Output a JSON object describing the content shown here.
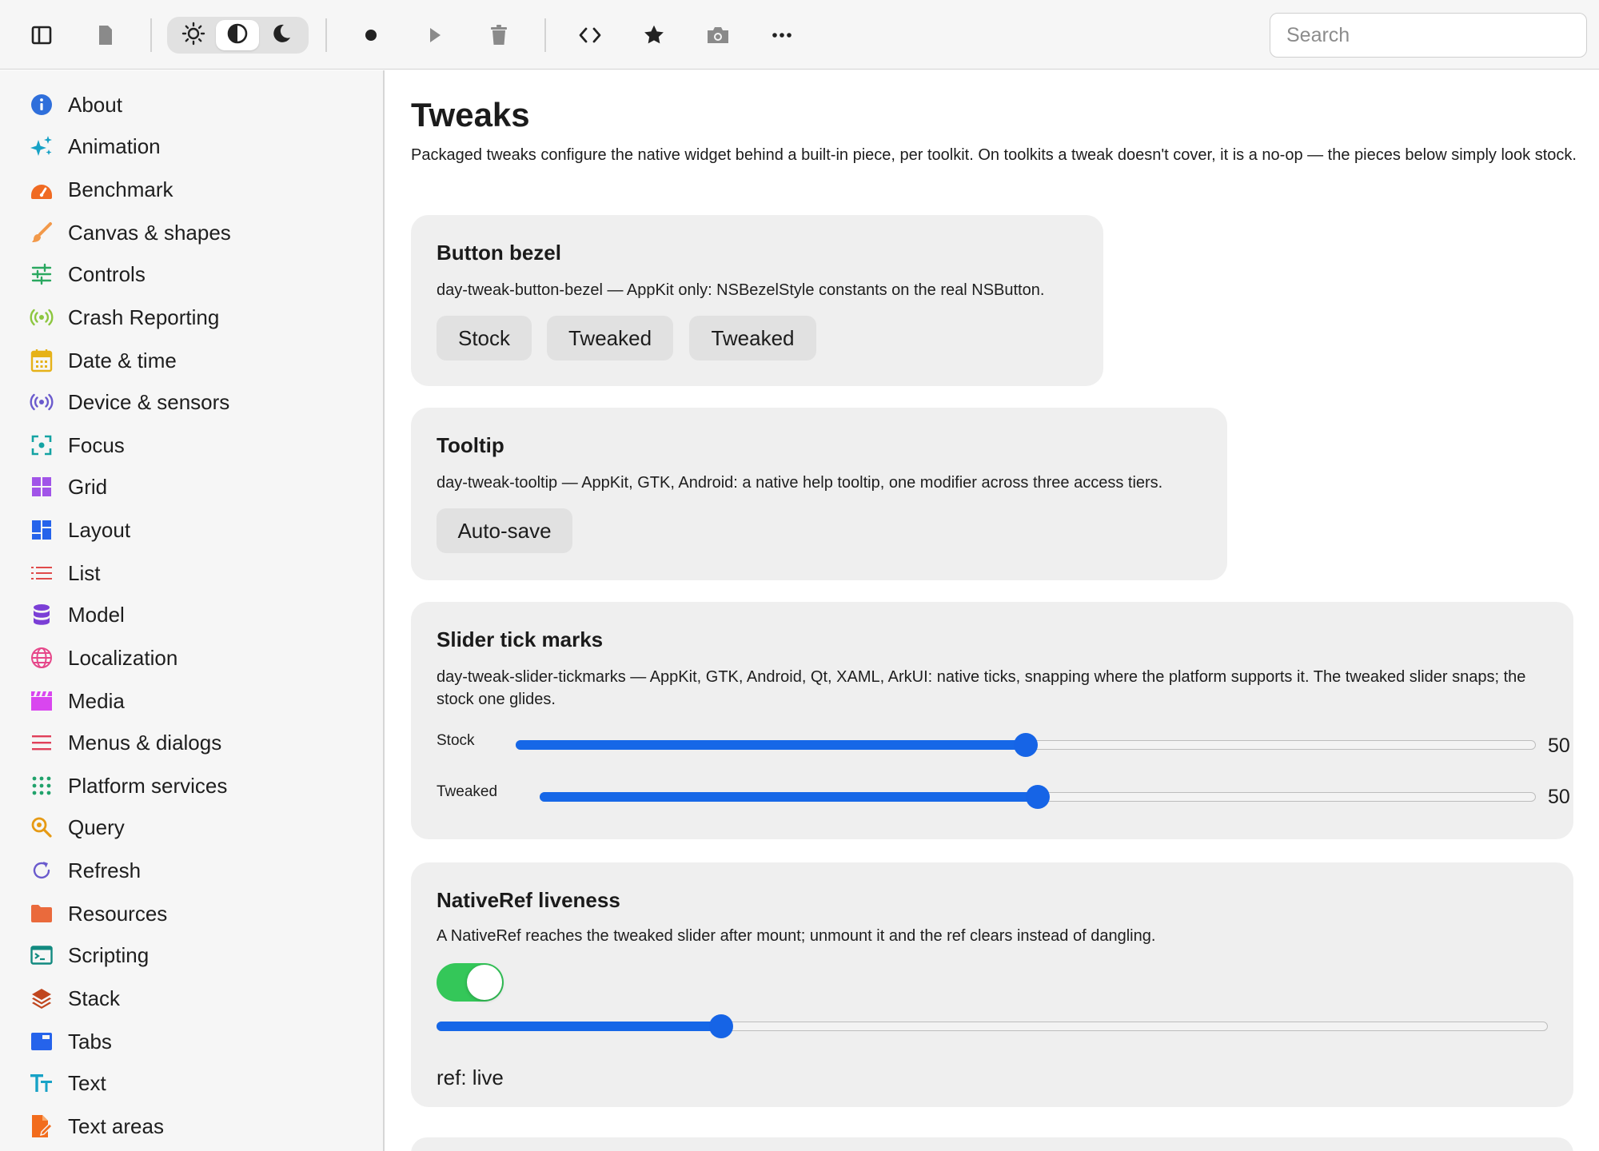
{
  "toolbar": {
    "icons": [
      "sidebar-toggle-icon",
      "document-icon",
      "sun-icon",
      "contrast-icon",
      "moon-icon",
      "record-icon",
      "play-icon",
      "trash-icon",
      "code-icon",
      "star-icon",
      "camera-icon",
      "more-icon"
    ],
    "theme_selected": "auto",
    "search_placeholder": "Search"
  },
  "sidebar": {
    "items": [
      {
        "label": "About",
        "icon": "info-icon",
        "color": "#2f6fdb"
      },
      {
        "label": "Animation",
        "icon": "sparkles-icon",
        "color": "#17a2c6"
      },
      {
        "label": "Benchmark",
        "icon": "gauge-icon",
        "color": "#f06a22"
      },
      {
        "label": "Canvas & shapes",
        "icon": "brush-icon",
        "color": "#f2994a"
      },
      {
        "label": "Controls",
        "icon": "sliders-icon",
        "color": "#2aa860"
      },
      {
        "label": "Crash Reporting",
        "icon": "broadcast-icon",
        "color": "#8cc63f"
      },
      {
        "label": "Date & time",
        "icon": "calendar-icon",
        "color": "#e6b219"
      },
      {
        "label": "Device & sensors",
        "icon": "sensor-icon",
        "color": "#6a5acd"
      },
      {
        "label": "Focus",
        "icon": "focus-icon",
        "color": "#14a3a3"
      },
      {
        "label": "Grid",
        "icon": "grid-icon",
        "color": "#a154e8"
      },
      {
        "label": "Layout",
        "icon": "layout-icon",
        "color": "#2563eb"
      },
      {
        "label": "List",
        "icon": "list-icon",
        "color": "#e04a4a"
      },
      {
        "label": "Model",
        "icon": "database-icon",
        "color": "#7b3fd6"
      },
      {
        "label": "Localization",
        "icon": "globe-icon",
        "color": "#e6478a"
      },
      {
        "label": "Media",
        "icon": "clapper-icon",
        "color": "#d946ef"
      },
      {
        "label": "Menus & dialogs",
        "icon": "menu-icon",
        "color": "#e0405a"
      },
      {
        "label": "Platform services",
        "icon": "dots-grid-icon",
        "color": "#20a26b"
      },
      {
        "label": "Query",
        "icon": "magnifier-icon",
        "color": "#e69a14"
      },
      {
        "label": "Refresh",
        "icon": "refresh-icon",
        "color": "#6a5acd"
      },
      {
        "label": "Resources",
        "icon": "folder-icon",
        "color": "#ea6a3c"
      },
      {
        "label": "Scripting",
        "icon": "terminal-icon",
        "color": "#128a80"
      },
      {
        "label": "Stack",
        "icon": "layers-icon",
        "color": "#c0461e"
      },
      {
        "label": "Tabs",
        "icon": "tabs-icon",
        "color": "#2563eb"
      },
      {
        "label": "Text",
        "icon": "text-size-icon",
        "color": "#17a2c6"
      },
      {
        "label": "Text areas",
        "icon": "edit-document-icon",
        "color": "#f26c1c"
      }
    ]
  },
  "main": {
    "title": "Tweaks",
    "description": "Packaged tweaks configure the native widget behind a built-in piece, per toolkit. On toolkits a tweak doesn't cover, it is a no-op — the pieces below simply look stock.",
    "cards": {
      "button_bezel": {
        "title": "Button bezel",
        "description": "day-tweak-button-bezel — AppKit only: NSBezelStyle constants on the real NSButton.",
        "buttons": [
          "Stock",
          "Tweaked",
          "Tweaked"
        ]
      },
      "tooltip": {
        "title": "Tooltip",
        "description": "day-tweak-tooltip — AppKit, GTK, Android: a native help tooltip, one modifier across three access tiers.",
        "button": "Auto-save"
      },
      "slider_ticks": {
        "title": "Slider tick marks",
        "description": "day-tweak-slider-tickmarks — AppKit, GTK, Android, Qt, XAML, ArkUI: native ticks, snapping where the platform supports it. The tweaked slider snaps; the stock one glides.",
        "stock_label": "Stock",
        "stock_value": "50",
        "tweaked_label": "Tweaked",
        "tweaked_value": "50",
        "stock_fraction": 0.5,
        "tweaked_fraction": 0.5
      },
      "nativeref": {
        "title": "NativeRef liveness",
        "description": "A NativeRef reaches the tweaked slider after mount; unmount it and the ref clears instead of dangling.",
        "toggle_on": true,
        "slider_fraction": 0.256,
        "status": "ref: live"
      }
    }
  },
  "colors": {
    "accent": "#1667e7",
    "toggle_on": "#34c759",
    "card_bg": "#efefef",
    "chrome_bg": "#f6f6f6"
  }
}
